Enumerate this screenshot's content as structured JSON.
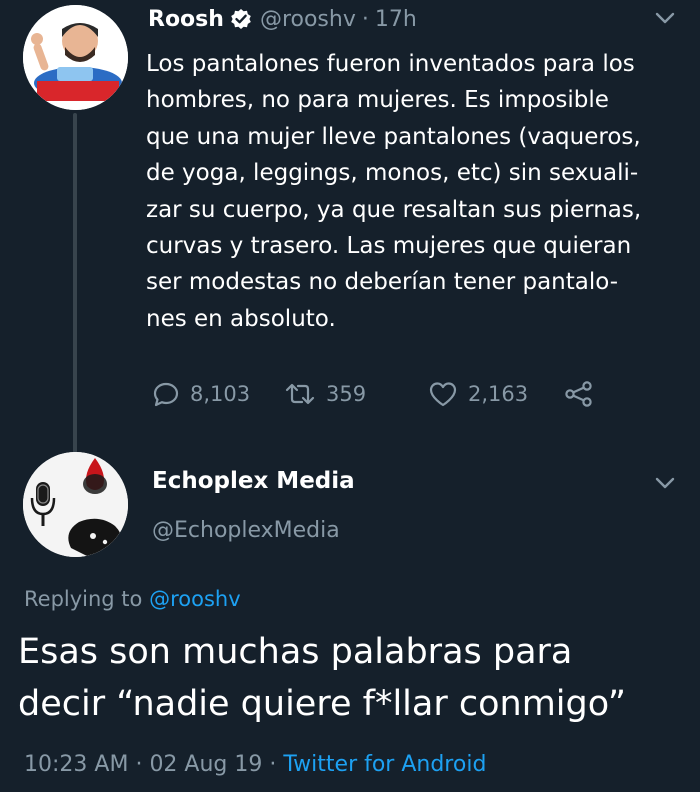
{
  "tweet": {
    "author_name": "Roosh",
    "author_handle": "@rooshv",
    "time_ago": "17h",
    "text_lines": [
      "Los pantalones fueron inventados para los",
      "hombres, no para mujeres. Es imposible",
      "que una mujer lleve pantalones (vaqueros,",
      "de yoga, leggings, monos, etc) sin sexuali-",
      "zar su cuerpo, ya que resaltan sus piernas,",
      "curvas y trasero. Las mujeres que quieran",
      "ser modestas no deberían tener pantalo-",
      "nes en absoluto."
    ],
    "replies_count": "8,103",
    "retweets_count": "359",
    "likes_count": "2,163"
  },
  "reply": {
    "author_name": "Echoplex Media",
    "author_handle": "@EchoplexMedia",
    "replying_prefix": "Replying to",
    "replying_to": "@rooshv",
    "text_lines": [
      "Esas son muchas palabras para",
      "decir “nadie quiere f*llar conmigo”"
    ],
    "time": "10:23 AM",
    "date": "02 Aug 19",
    "source": "Twitter for Android"
  },
  "icons": {
    "verified": "verified-badge-icon",
    "chevron": "chevron-down-icon",
    "reply": "reply-icon",
    "retweet": "retweet-icon",
    "like": "heart-icon",
    "share": "share-icon"
  },
  "colors": {
    "background": "#15202b",
    "primary_text": "#ffffff",
    "secondary_text": "#8899a6",
    "link": "#1da1f2",
    "thread_line": "#38444d"
  }
}
